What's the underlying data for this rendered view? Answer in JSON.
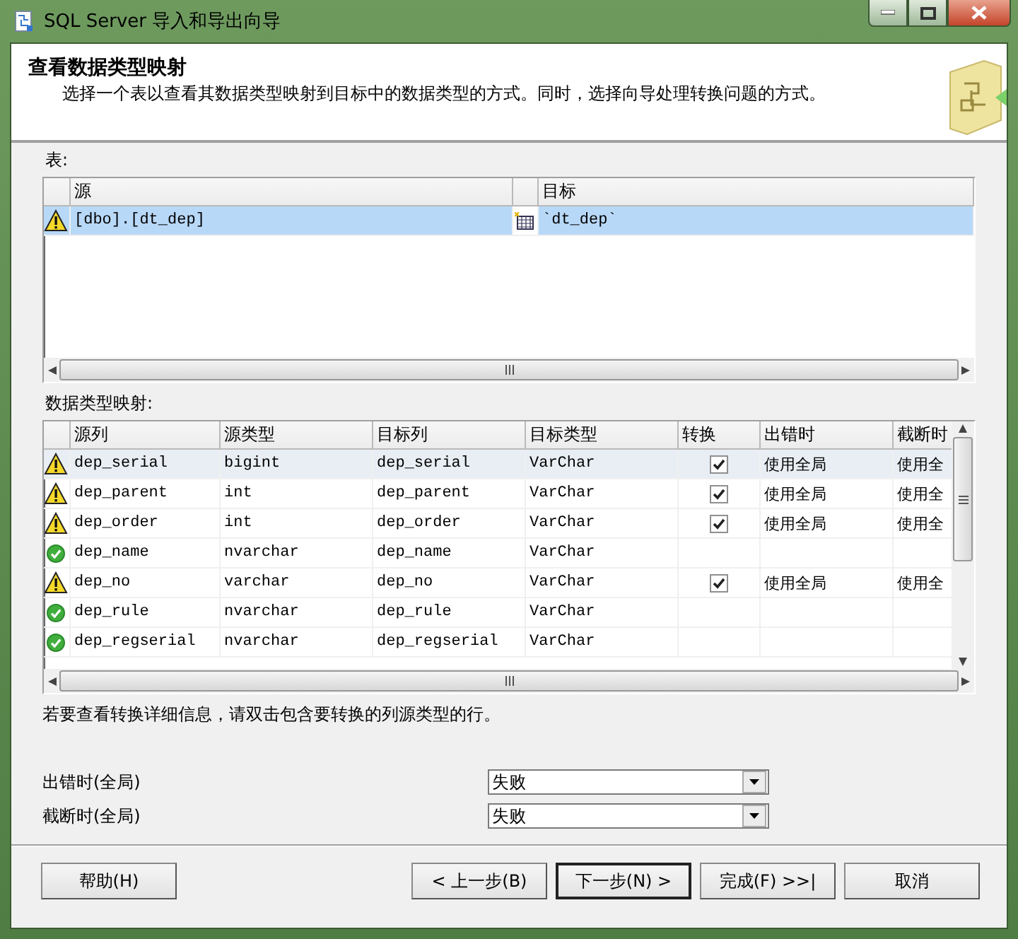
{
  "window": {
    "title": "SQL Server 导入和导出向导"
  },
  "header": {
    "title": "查看数据类型映射",
    "description": "选择一个表以查看其数据类型映射到目标中的数据类型的方式。同时，选择向导处理转换问题的方式。"
  },
  "tables_label": "表:",
  "tables": {
    "columns": [
      "源",
      "目标"
    ],
    "rows": [
      {
        "kind": "warning",
        "source": "[dbo].[dt_dep]",
        "destination": "`dt_dep`",
        "selected": true
      }
    ]
  },
  "mapping_label": "数据类型映射:",
  "mapping": {
    "columns": [
      "源列",
      "源类型",
      "目标列",
      "目标类型",
      "转换",
      "出错时",
      "截断时"
    ],
    "rows": [
      {
        "kind": "warning",
        "source_column": "dep_serial",
        "source_type": "bigint",
        "dest_column": "dep_serial",
        "dest_type": "VarChar",
        "convert": true,
        "on_error": "使用全局",
        "on_truncate": "使用全",
        "selected": true
      },
      {
        "kind": "warning",
        "source_column": "dep_parent",
        "source_type": "int",
        "dest_column": "dep_parent",
        "dest_type": "VarChar",
        "convert": true,
        "on_error": "使用全局",
        "on_truncate": "使用全",
        "selected": false
      },
      {
        "kind": "warning",
        "source_column": "dep_order",
        "source_type": "int",
        "dest_column": "dep_order",
        "dest_type": "VarChar",
        "convert": true,
        "on_error": "使用全局",
        "on_truncate": "使用全",
        "selected": false
      },
      {
        "kind": "ok",
        "source_column": "dep_name",
        "source_type": "nvarchar",
        "dest_column": "dep_name",
        "dest_type": "VarChar",
        "selected": false
      },
      {
        "kind": "warning",
        "source_column": "dep_no",
        "source_type": "varchar",
        "dest_column": "dep_no",
        "dest_type": "VarChar",
        "convert": true,
        "on_error": "使用全局",
        "on_truncate": "使用全",
        "selected": false
      },
      {
        "kind": "ok",
        "source_column": "dep_rule",
        "source_type": "nvarchar",
        "dest_column": "dep_rule",
        "dest_type": "VarChar",
        "selected": false
      },
      {
        "kind": "ok",
        "source_column": "dep_regserial",
        "source_type": "nvarchar",
        "dest_column": "dep_regserial",
        "dest_type": "VarChar",
        "selected": false
      }
    ]
  },
  "hint": "若要查看转换详细信息，请双击包含要转换的列源类型的行。",
  "global_settings": [
    {
      "label": "出错时(全局)",
      "value": "失败"
    },
    {
      "label": "截断时(全局)",
      "value": "失败"
    }
  ],
  "buttons": [
    {
      "label": "帮助(H)",
      "kind": "help",
      "default": false
    },
    {
      "label": "< 上一步(B)",
      "kind": "nav",
      "default": false
    },
    {
      "label": "下一步(N) >",
      "kind": "nav",
      "default": true
    },
    {
      "label": "完成(F) >>|",
      "kind": "nav",
      "default": false
    },
    {
      "label": "取消",
      "kind": "cancel",
      "default": false
    }
  ]
}
